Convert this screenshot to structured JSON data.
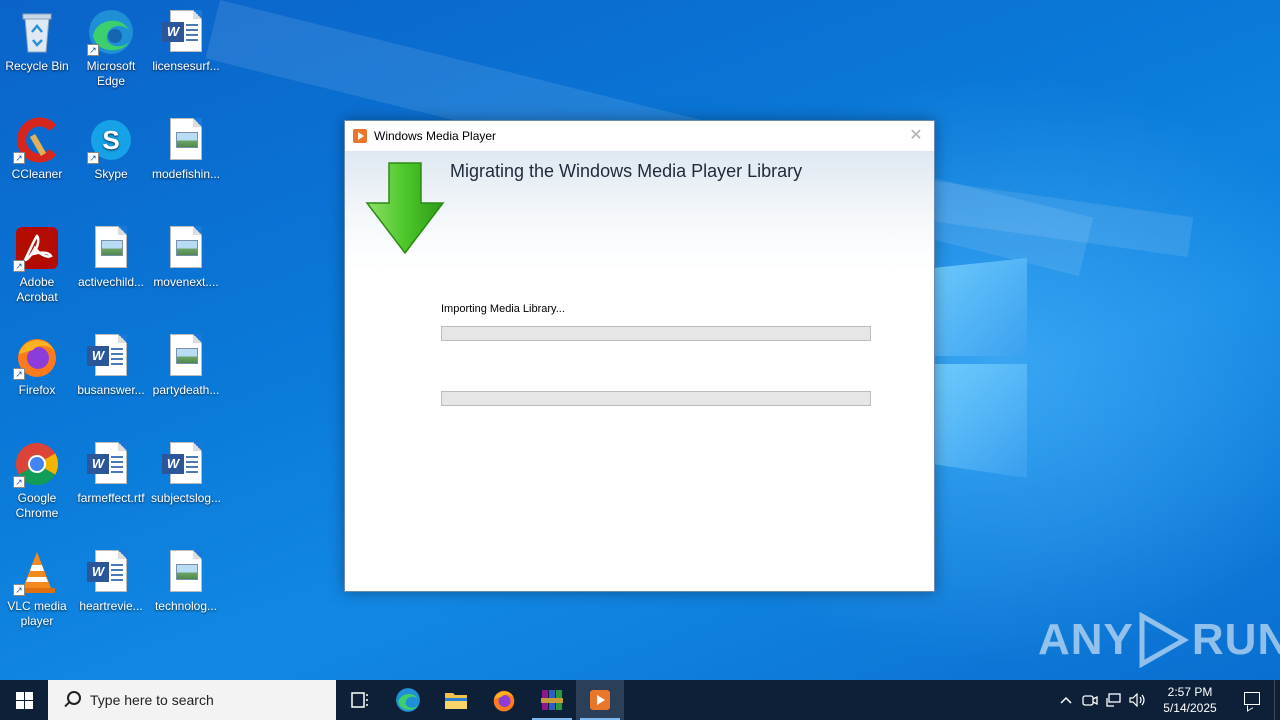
{
  "desktop": {
    "icons": [
      {
        "label": "Recycle Bin",
        "kind": "recycle-bin"
      },
      {
        "label": "Microsoft Edge",
        "kind": "edge"
      },
      {
        "label": "licensesurf...",
        "kind": "word-doc"
      },
      {
        "label": "CCleaner",
        "kind": "ccleaner"
      },
      {
        "label": "Skype",
        "kind": "skype"
      },
      {
        "label": "modefishin...",
        "kind": "image-file"
      },
      {
        "label": "Adobe Acrobat",
        "kind": "acrobat"
      },
      {
        "label": "activechild...",
        "kind": "image-file"
      },
      {
        "label": "movenext....",
        "kind": "image-file"
      },
      {
        "label": "Firefox",
        "kind": "firefox"
      },
      {
        "label": "busanswer...",
        "kind": "word-doc"
      },
      {
        "label": "partydeath...",
        "kind": "image-file"
      },
      {
        "label": "Google Chrome",
        "kind": "chrome"
      },
      {
        "label": "farmeffect.rtf",
        "kind": "word-doc"
      },
      {
        "label": "subjectslog...",
        "kind": "word-doc"
      },
      {
        "label": "VLC media player",
        "kind": "vlc"
      },
      {
        "label": "heartrevie...",
        "kind": "word-doc"
      },
      {
        "label": "technolog...",
        "kind": "image-file"
      }
    ]
  },
  "dialog": {
    "title": "Windows Media Player",
    "heading": "Migrating the Windows Media Player Library",
    "status": "Importing Media Library...",
    "progress_primary": 0,
    "progress_secondary": 0,
    "close_glyph": "✕"
  },
  "taskbar": {
    "search_placeholder": "Type here to search",
    "pinned": [
      "task-view",
      "edge",
      "file-explorer",
      "firefox",
      "winrar",
      "windows-media-player"
    ],
    "active": "windows-media-player",
    "clock_time": "2:57 PM",
    "clock_date": "5/14/2025"
  },
  "watermark": {
    "text_left": "ANY",
    "text_right": "RUN"
  },
  "colors": {
    "desktop_blue": "#0a78d7",
    "taskbar": "#0d2038",
    "progress_green": "#06b025",
    "arrow_green": "#4cc72a"
  }
}
